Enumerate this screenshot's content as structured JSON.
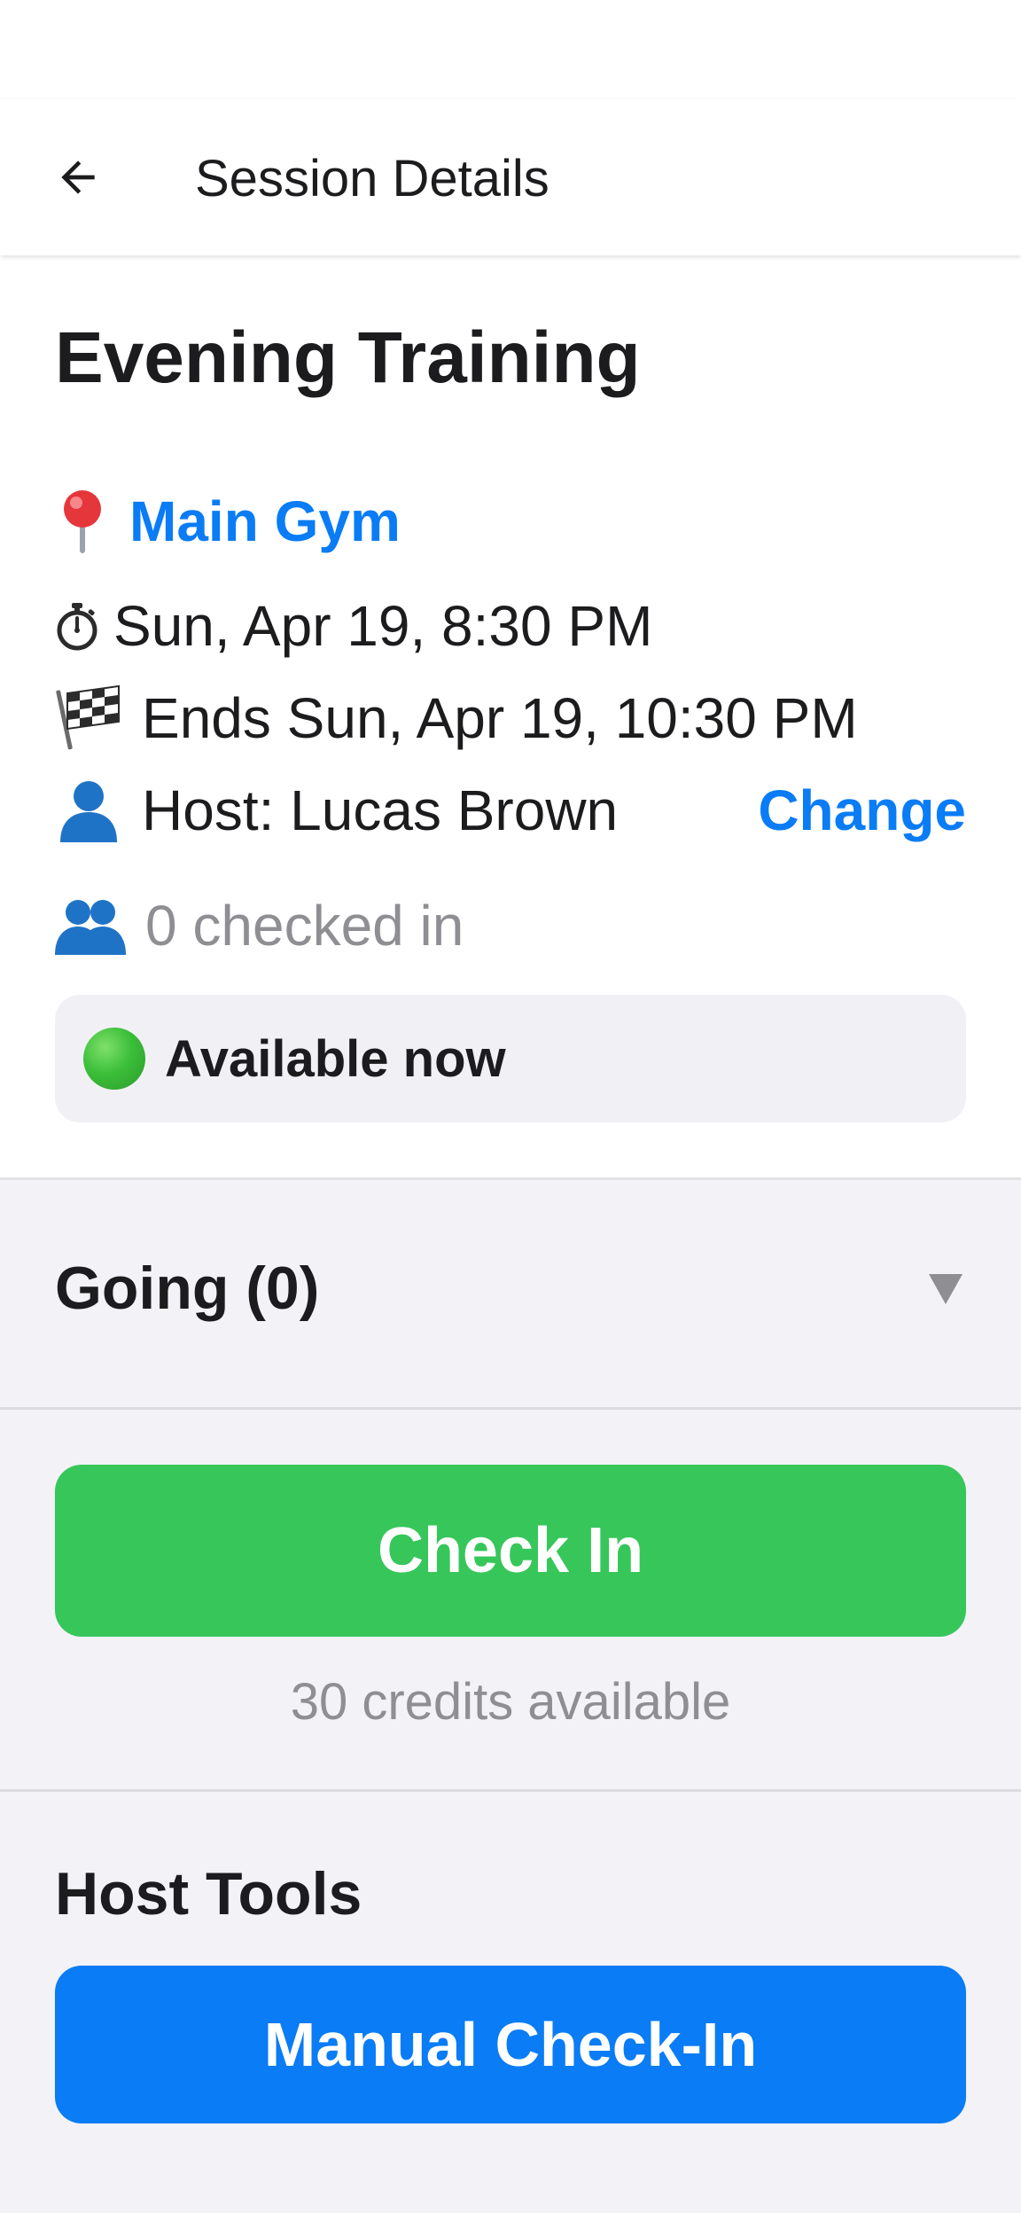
{
  "header": {
    "title": "Session Details",
    "back_icon": "arrow-left-icon"
  },
  "session": {
    "title": "Evening Training",
    "location": "Main Gym",
    "start": "Sun, Apr 19, 8:30 PM",
    "end": "Ends Sun, Apr 19, 10:30 PM",
    "host": "Host: Lucas Brown",
    "change_label": "Change",
    "checked_in": "0 checked in",
    "availability": "Available now"
  },
  "going": {
    "title": "Going (0)",
    "toggle_icon": "triangle-down-icon"
  },
  "checkin": {
    "button_label": "Check In",
    "credits": "30 credits available"
  },
  "host_tools": {
    "title": "Host Tools",
    "manual_button_label": "Manual Check-In"
  },
  "colors": {
    "accent_blue": "#0a7cf5",
    "success_green": "#37c65a",
    "muted_gray": "#8e8e93",
    "background": "#f2f2f7"
  }
}
